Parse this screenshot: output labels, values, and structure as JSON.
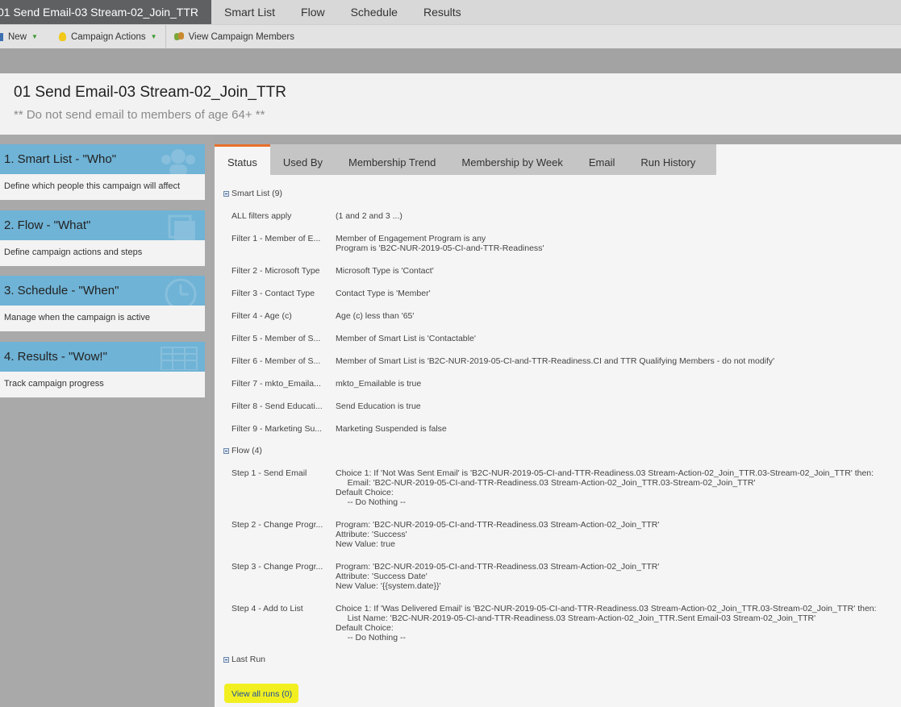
{
  "top_tabs": [
    "01 Send Email-03 Stream-02_Join_TTR",
    "Smart List",
    "Flow",
    "Schedule",
    "Results"
  ],
  "toolbar": {
    "new_label": "New",
    "campaign_actions_label": "Campaign Actions",
    "view_members_label": "View Campaign Members"
  },
  "header": {
    "title": "01 Send Email-03 Stream-02_Join_TTR",
    "subtitle": "** Do not send email to members of age 64+ **"
  },
  "cards": [
    {
      "title": "1. Smart List - \"Who\"",
      "desc": "Define which people this campaign will affect",
      "icon": "people-icon"
    },
    {
      "title": "2. Flow - \"What\"",
      "desc": "Define campaign actions and steps",
      "icon": "stack-icon"
    },
    {
      "title": "3. Schedule - \"When\"",
      "desc": "Manage when the campaign is active",
      "icon": "clock-icon"
    },
    {
      "title": "4. Results - \"Wow!\"",
      "desc": "Track campaign progress",
      "icon": "grid-icon"
    }
  ],
  "main_tabs": [
    "Status",
    "Used By",
    "Membership Trend",
    "Membership by Week",
    "Email",
    "Run History"
  ],
  "smart_list": {
    "header": "Smart List (9)",
    "rows": [
      {
        "label": "ALL filters apply",
        "value": "(1 and 2 and 3 ...)"
      },
      {
        "label": "Filter 1 - Member of E...",
        "value": "Member of Engagement Program is any\nProgram is 'B2C-NUR-2019-05-CI-and-TTR-Readiness'"
      },
      {
        "label": "Filter 2 - Microsoft Type",
        "value": "Microsoft Type is 'Contact'"
      },
      {
        "label": "Filter 3 - Contact Type",
        "value": "Contact Type is 'Member'"
      },
      {
        "label": "Filter 4 - Age (c)",
        "value": "Age (c) less than '65'"
      },
      {
        "label": "Filter 5 - Member of S...",
        "value": "Member of Smart List is 'Contactable'"
      },
      {
        "label": "Filter 6 - Member of S...",
        "value": "Member of Smart List is 'B2C-NUR-2019-05-CI-and-TTR-Readiness.CI and TTR Qualifying Members - do not modify'"
      },
      {
        "label": "Filter 7 - mkto_Emaila...",
        "value": "mkto_Emailable is true"
      },
      {
        "label": "Filter 8 - Send Educati...",
        "value": "Send Education is true"
      },
      {
        "label": "Filter 9 - Marketing Su...",
        "value": "Marketing Suspended is false"
      }
    ]
  },
  "flow": {
    "header": "Flow (4)",
    "rows": [
      {
        "label": "Step 1 - Send Email",
        "value": "Choice 1: If 'Not Was Sent Email' is 'B2C-NUR-2019-05-CI-and-TTR-Readiness.03 Stream-Action-02_Join_TTR.03-Stream-02_Join_TTR' then:\n     Email: 'B2C-NUR-2019-05-CI-and-TTR-Readiness.03 Stream-Action-02_Join_TTR.03-Stream-02_Join_TTR'\nDefault Choice:\n     -- Do Nothing --"
      },
      {
        "label": "Step 2 - Change Progr...",
        "value": "Program: 'B2C-NUR-2019-05-CI-and-TTR-Readiness.03 Stream-Action-02_Join_TTR'\nAttribute: 'Success'\nNew Value: true"
      },
      {
        "label": "Step 3 - Change Progr...",
        "value": "Program: 'B2C-NUR-2019-05-CI-and-TTR-Readiness.03 Stream-Action-02_Join_TTR'\nAttribute: 'Success Date'\nNew Value: '{{system.date}}'"
      },
      {
        "label": "Step 4 - Add to List",
        "value": "Choice 1: If 'Was Delivered Email' is 'B2C-NUR-2019-05-CI-and-TTR-Readiness.03 Stream-Action-02_Join_TTR.03-Stream-02_Join_TTR' then:\n     List Name: 'B2C-NUR-2019-05-CI-and-TTR-Readiness.03 Stream-Action-02_Join_TTR.Sent Email-03 Stream-02_Join_TTR'\nDefault Choice:\n     -- Do Nothing --"
      }
    ]
  },
  "last_run": {
    "header": "Last Run"
  },
  "view_all_runs": "View all runs (0)",
  "colors": {
    "accent_tab": "#e8702a",
    "card_head": "#6fb3d6",
    "highlight": "#f2ef21",
    "link": "#1a4f9c"
  }
}
